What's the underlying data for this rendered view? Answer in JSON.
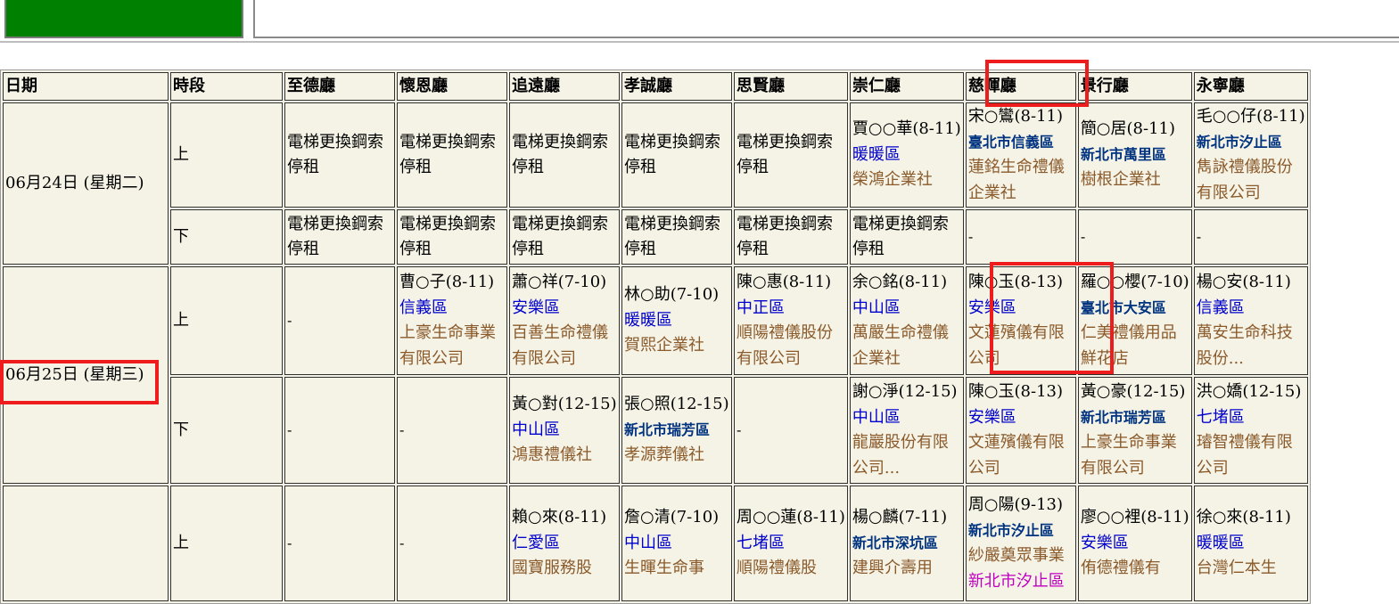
{
  "colors": {
    "accent_green": "#008000",
    "highlight_red": "#ee1c1c",
    "table_bg": "#f5f3e6"
  },
  "headers": [
    "日期",
    "時段",
    "至德廳",
    "懷恩廳",
    "追遠廳",
    "孝誠廳",
    "思賢廳",
    "崇仁廳",
    "慈暉廳",
    "景行廳",
    "永寧廳"
  ],
  "days": [
    {
      "date": "06月24日 (星期二)",
      "slots": [
        {
          "slot": "上",
          "cells": [
            {
              "text": "電梯更換鋼索停租"
            },
            {
              "text": "電梯更換鋼索停租"
            },
            {
              "text": "電梯更換鋼索停租"
            },
            {
              "text": "電梯更換鋼索停租"
            },
            {
              "text": "電梯更換鋼索停租"
            },
            {
              "name": "賈○○華(8-11)",
              "district": "暖暖區",
              "dstyle": "blue",
              "company": "榮鴻企業社"
            },
            {
              "name": "宋○鸞(8-11)",
              "district": "臺北市信義區",
              "dstyle": "navy",
              "company": "蓮銘生命禮儀企業社"
            },
            {
              "name": "簡○居(8-11)",
              "district": "新北市萬里區",
              "dstyle": "navy",
              "company": "樹根企業社"
            },
            {
              "name": "毛○○仔(8-11)",
              "district": "新北市汐止區",
              "dstyle": "navy",
              "company": "雋詠禮儀股份有限公司"
            }
          ]
        },
        {
          "slot": "下",
          "cells": [
            {
              "text": "電梯更換鋼索停租"
            },
            {
              "text": "電梯更換鋼索停租"
            },
            {
              "text": "電梯更換鋼索停租"
            },
            {
              "text": "電梯更換鋼索停租"
            },
            {
              "text": "電梯更換鋼索停租"
            },
            {
              "text": "電梯更換鋼索停租"
            },
            {
              "dash": "-"
            },
            {
              "dash": "-"
            },
            {
              "dash": "-"
            }
          ]
        }
      ]
    },
    {
      "date": "06月25日 (星期三)",
      "slots": [
        {
          "slot": "上",
          "cells": [
            {
              "dash": "-"
            },
            {
              "name": "曹○子(8-11)",
              "district": "信義區",
              "dstyle": "blue",
              "company": "上豪生命事業有限公司"
            },
            {
              "name": "蕭○祥(7-10)",
              "district": "安樂區",
              "dstyle": "blue",
              "company": "百善生命禮儀有限公司"
            },
            {
              "name": "林○助(7-10)",
              "district": "暖暖區",
              "dstyle": "blue",
              "company": "賀熙企業社"
            },
            {
              "name": "陳○惠(8-11)",
              "district": "中正區",
              "dstyle": "blue",
              "company": "順陽禮儀股份有限公司"
            },
            {
              "name": "余○銘(8-11)",
              "district": "中山區",
              "dstyle": "blue",
              "company": "萬嚴生命禮儀企業社"
            },
            {
              "name": "陳○玉(8-13)",
              "district": "安樂區",
              "dstyle": "blue",
              "company": "文蓮殯儀有限公司"
            },
            {
              "name": "羅○○櫻(7-10)",
              "district": "臺北市大安區",
              "dstyle": "navy",
              "company": "仁美禮儀用品鮮花店"
            },
            {
              "name": "楊○安(8-11)",
              "district": "信義區",
              "dstyle": "blue",
              "company": "萬安生命科技股份..."
            }
          ]
        },
        {
          "slot": "下",
          "cells": [
            {
              "dash": "-"
            },
            {
              "dash": "-"
            },
            {
              "name": "黃○對(12-15)",
              "district": "中山區",
              "dstyle": "blue",
              "company": "鴻惠禮儀社"
            },
            {
              "name": "張○照(12-15)",
              "district": "新北市瑞芳區",
              "dstyle": "navy",
              "company": "孝源葬儀社"
            },
            {
              "dash": "-"
            },
            {
              "name": "謝○淨(12-15)",
              "district": "中山區",
              "dstyle": "blue",
              "company": "龍巖股份有限公司..."
            },
            {
              "name": "陳○玉(8-13)",
              "district": "安樂區",
              "dstyle": "blue",
              "company": "文蓮殯儀有限公司"
            },
            {
              "name": "黃○豪(12-15)",
              "district": "新北市瑞芳區",
              "dstyle": "navy",
              "company": "上豪生命事業有限公司"
            },
            {
              "name": "洪○嬌(12-15)",
              "district": "七堵區",
              "dstyle": "blue",
              "company": "璿智禮儀有限公司"
            }
          ]
        }
      ]
    },
    {
      "date": "",
      "slots": [
        {
          "slot": "上",
          "cells": [
            {
              "dash": "-"
            },
            {
              "dash": "-"
            },
            {
              "name": "賴○來(8-11)",
              "district": "仁愛區",
              "dstyle": "blue",
              "company": "國寶服務股"
            },
            {
              "name": "詹○清(7-10)",
              "district": "中山區",
              "dstyle": "blue",
              "company": "生暉生命事"
            },
            {
              "name": "周○○蓮(8-11)",
              "district": "七堵區",
              "dstyle": "blue",
              "company": "順陽禮儀股"
            },
            {
              "name": "楊○麟(7-11)",
              "district": "新北市深坑區",
              "dstyle": "navy",
              "company": "建興介壽用"
            },
            {
              "name": "周○陽(9-13)",
              "district": "新北市汐止區",
              "dstyle": "navy",
              "company": "紗嚴奠眾事業",
              "extra": "新北市汐止區"
            },
            {
              "name": "廖○○裡(8-11)",
              "district": "安樂區",
              "dstyle": "blue",
              "company": "侑德禮儀有"
            },
            {
              "name": "徐○來(8-11)",
              "district": "暖暖區",
              "dstyle": "blue",
              "company": "台灣仁本生"
            }
          ]
        }
      ]
    }
  ]
}
